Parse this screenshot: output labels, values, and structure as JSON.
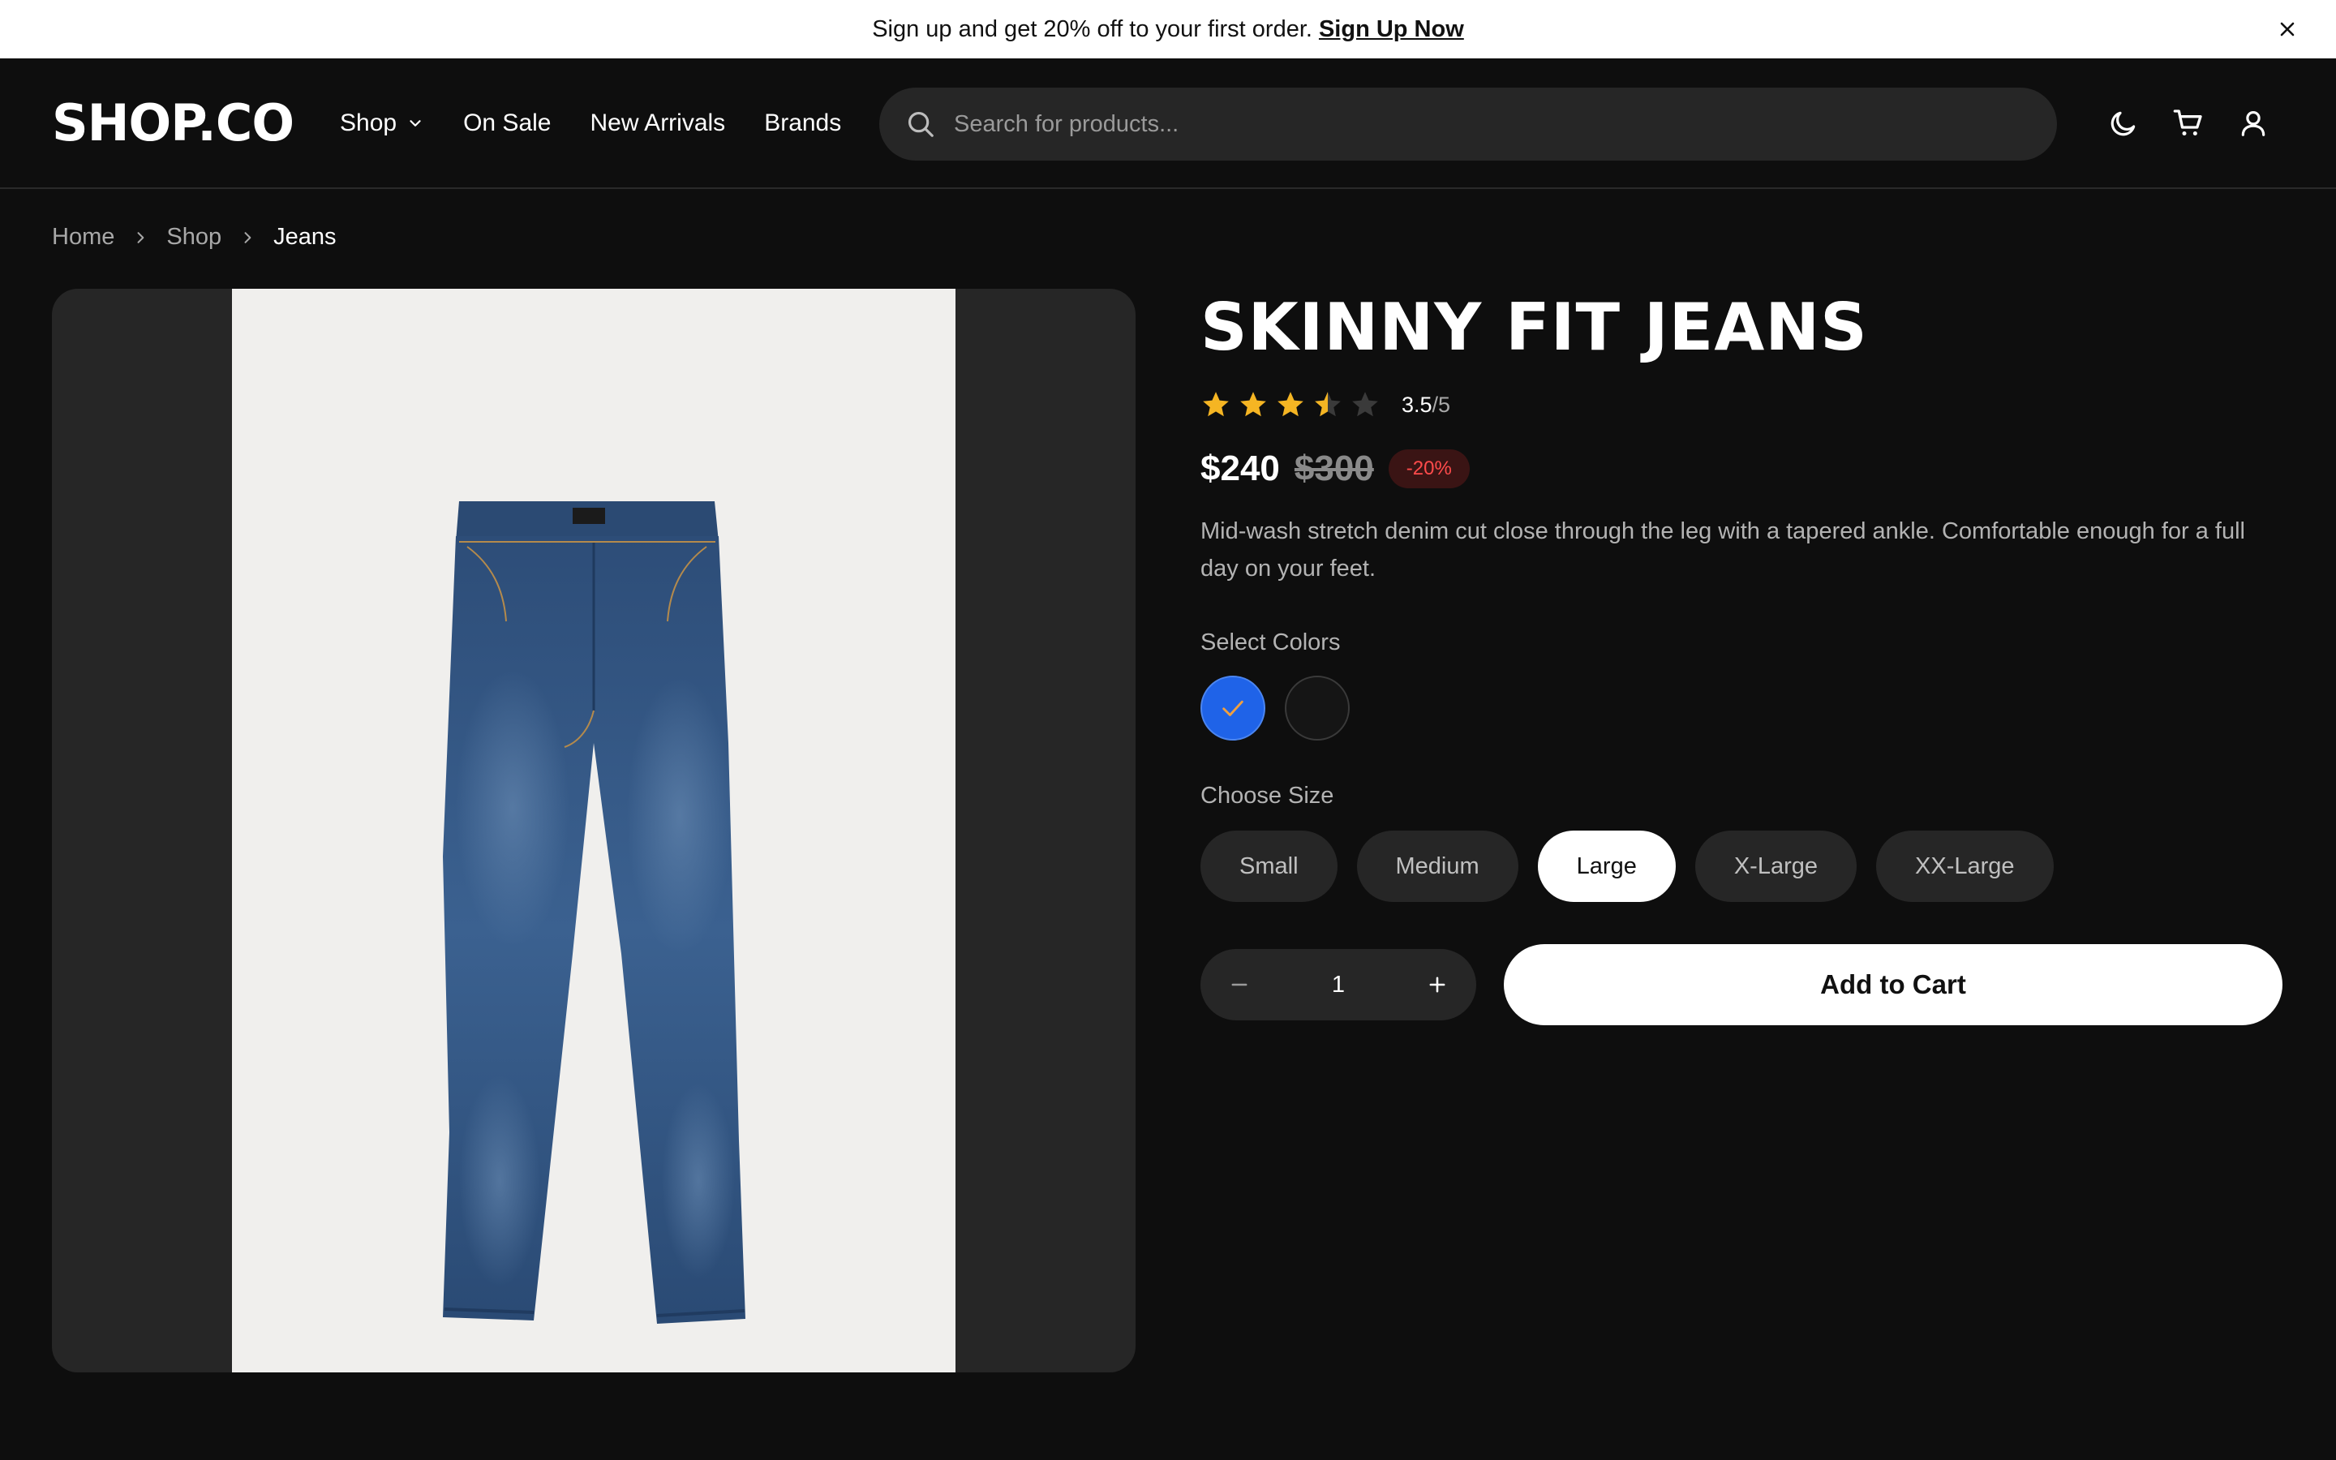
{
  "promo": {
    "text": "Sign up and get 20% off to your first order.",
    "link": "Sign Up Now"
  },
  "header": {
    "logo": "SHOP.CO",
    "nav": [
      "Shop",
      "On Sale",
      "New Arrivals",
      "Brands"
    ],
    "search_placeholder": "Search for products...",
    "icons": [
      "moon-icon",
      "cart-icon",
      "user-icon"
    ]
  },
  "breadcrumb": [
    "Home",
    "Shop",
    "Jeans"
  ],
  "product": {
    "title": "SKINNY FIT JEANS",
    "rating": "3.5",
    "rating_max": "/5",
    "rating_value": 3.5,
    "price": "$240",
    "old_price": "$300",
    "discount": "-20%",
    "description": "Mid-wash stretch denim cut close through the leg with a tapered ankle. Comfortable enough for a full day on your feet.",
    "colors_label": "Select Colors",
    "colors": [
      {
        "name": "blue",
        "hex": "#1f63e8",
        "selected": true
      },
      {
        "name": "black",
        "hex": "#151515",
        "selected": false
      }
    ],
    "size_label": "Choose Size",
    "sizes": [
      "Small",
      "Medium",
      "Large",
      "X-Large",
      "XX-Large"
    ],
    "selected_size": "Large",
    "quantity": "1",
    "add_to_cart": "Add to Cart"
  },
  "colors": {
    "accent_star": "#f5b523",
    "discount_text": "#ff4b4b",
    "discount_bg": "#3a1414",
    "background": "#0e0e0e"
  }
}
